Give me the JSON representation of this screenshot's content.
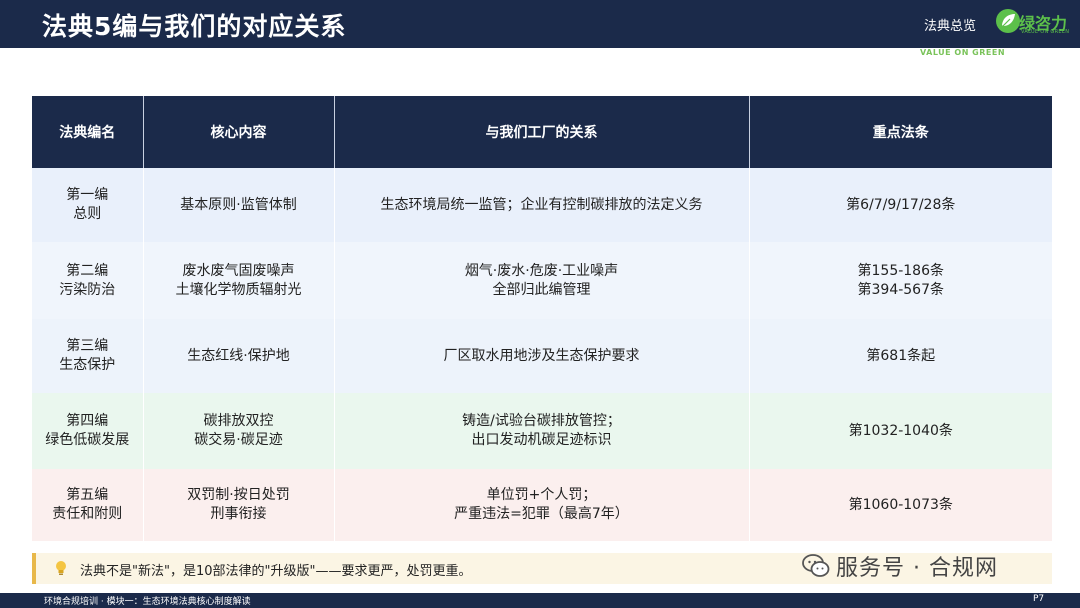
{
  "header": {
    "title": "法典5编与我们的对应关系",
    "section": "法典总览",
    "logo_text": "绿咨力",
    "logo_tagline": "VALUE ON GREEN"
  },
  "table": {
    "columns": [
      "法典编名",
      "核心内容",
      "与我们工厂的关系",
      "重点法条"
    ],
    "rows": [
      {
        "name": "第一编\n总则",
        "core": "基本原则·监管体制",
        "relation": "生态环境局统一监管；企业有控制碳排放的法定义务",
        "articles": "第6/7/9/17/28条"
      },
      {
        "name": "第二编\n污染防治",
        "core": "废水废气固废噪声\n土壤化学物质辐射光",
        "relation": "烟气·废水·危废·工业噪声\n全部归此编管理",
        "articles": "第155-186条\n第394-567条"
      },
      {
        "name": "第三编\n生态保护",
        "core": "生态红线·保护地",
        "relation": "厂区取水用地涉及生态保护要求",
        "articles": "第681条起"
      },
      {
        "name": "第四编\n绿色低碳发展",
        "core": "碳排放双控\n碳交易·碳足迹",
        "relation": "铸造/试验台碳排放管控；\n出口发动机碳足迹标识",
        "articles": "第1032-1040条"
      },
      {
        "name": "第五编\n责任和附则",
        "core": "双罚制·按日处罚\n刑事衔接",
        "relation": "单位罚+个人罚；\n严重违法=犯罪（最高7年）",
        "articles": "第1060-1073条"
      }
    ]
  },
  "tip": {
    "text": "法典不是\"新法\"，是10部法律的\"升级版\"——要求更严，处罚更重。"
  },
  "watermark": {
    "text": "服务号 · 合规网"
  },
  "footer": {
    "text": "环境合规培训 · 模块一：生态环境法典核心制度解读",
    "page": "P7"
  },
  "colors": {
    "navy": "#1b2a4a",
    "brand_green": "#5cc04a",
    "row_blue": "#e9f0fb",
    "row_green": "#eaf7ee",
    "row_red": "#fbefee",
    "tip_bg": "#fbf5e4",
    "tip_accent": "#e8b84a"
  },
  "icons": {
    "logo": "leaf-logo-icon",
    "tip": "lightbulb-icon",
    "watermark": "wechat-icon"
  }
}
